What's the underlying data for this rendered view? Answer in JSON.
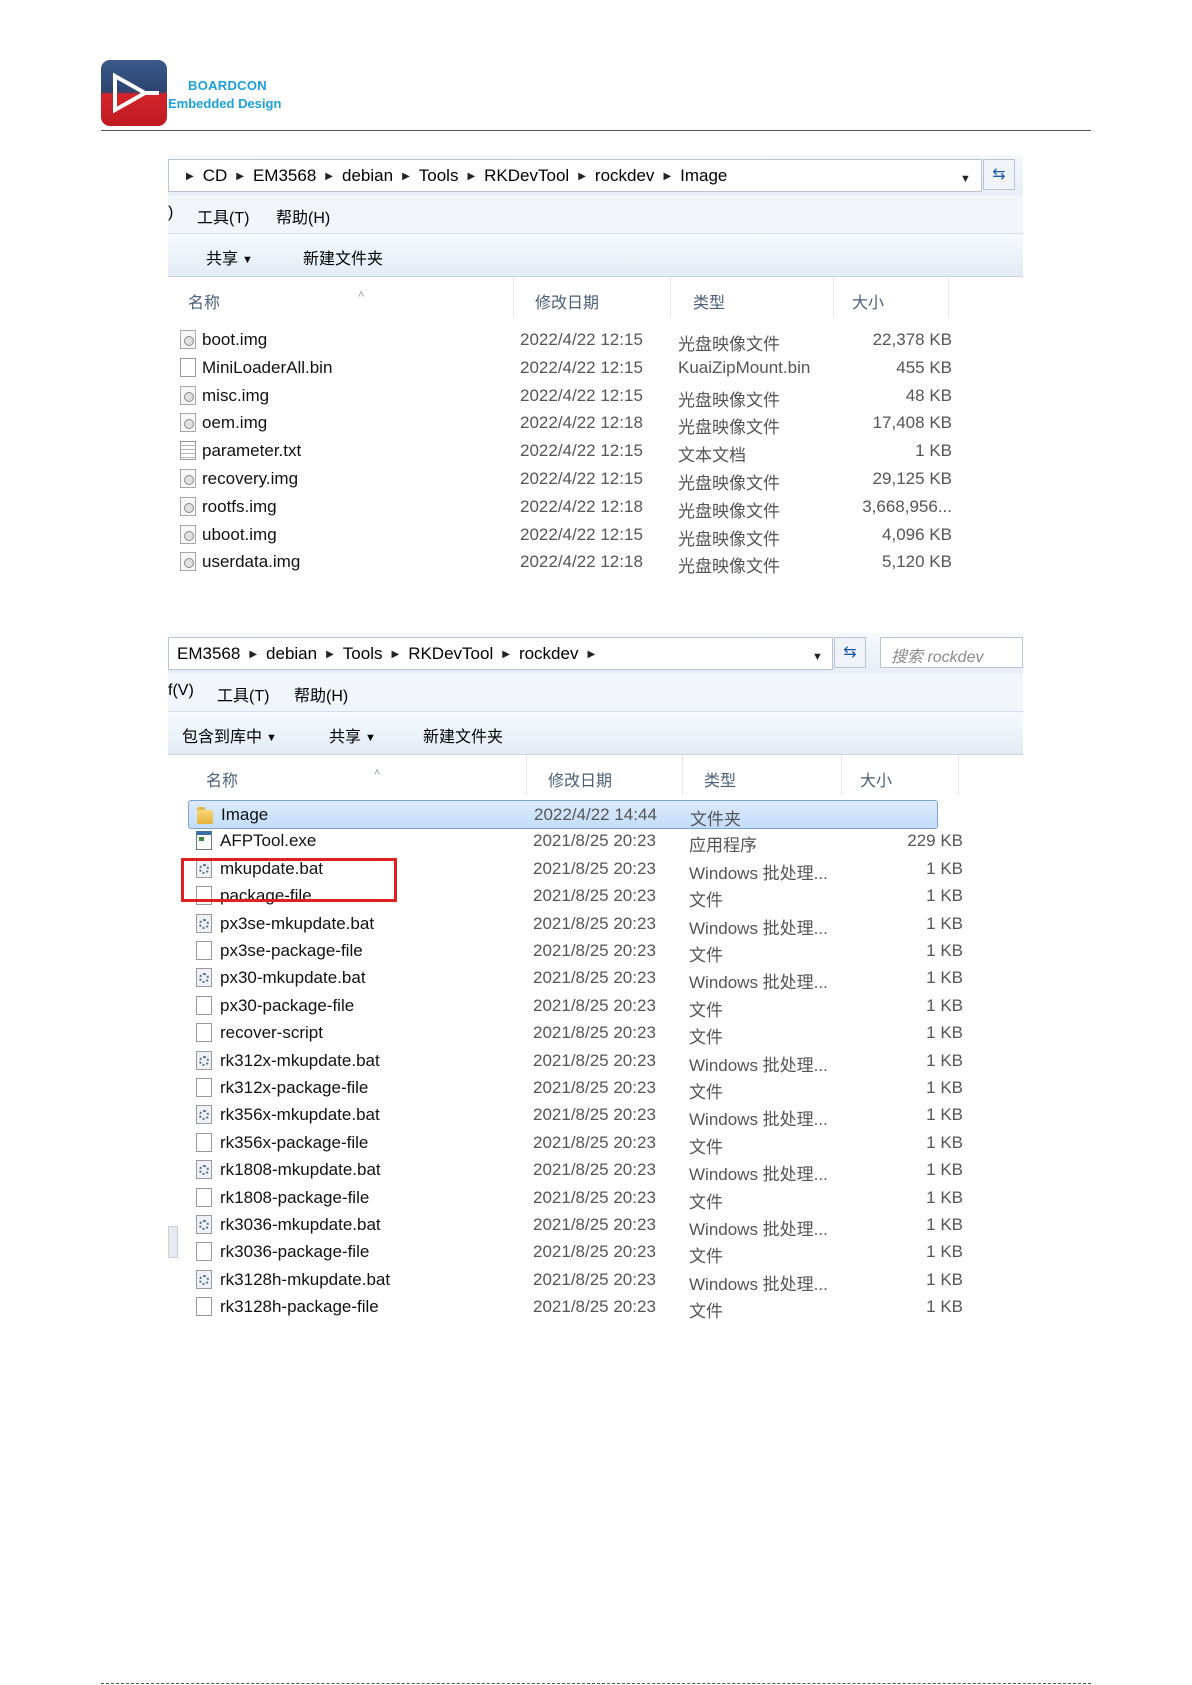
{
  "header": {
    "brand_name": "BOARDCON",
    "brand_sub": "Embedded Design"
  },
  "window1": {
    "breadcrumbs": [
      "CD",
      "EM3568",
      "debian",
      "Tools",
      "RKDevTool",
      "rockdev",
      "Image"
    ],
    "menus": [
      ")",
      "工具(T)",
      "帮助(H)"
    ],
    "commands": [
      "共享",
      "新建文件夹"
    ],
    "columns": {
      "name": "名称",
      "date": "修改日期",
      "type": "类型",
      "size": "大小"
    },
    "files": [
      {
        "name": "boot.img",
        "date": "2022/4/22 12:15",
        "type": "光盘映像文件",
        "size": "22,378 KB",
        "icon": "disc-image-icon"
      },
      {
        "name": "MiniLoaderAll.bin",
        "date": "2022/4/22 12:15",
        "type": "KuaiZipMount.bin",
        "size": "455 KB",
        "icon": "blank-file-icon"
      },
      {
        "name": "misc.img",
        "date": "2022/4/22 12:15",
        "type": "光盘映像文件",
        "size": "48 KB",
        "icon": "disc-image-icon"
      },
      {
        "name": "oem.img",
        "date": "2022/4/22 12:18",
        "type": "光盘映像文件",
        "size": "17,408 KB",
        "icon": "disc-image-icon"
      },
      {
        "name": "parameter.txt",
        "date": "2022/4/22 12:15",
        "type": "文本文档",
        "size": "1 KB",
        "icon": "text-file-icon"
      },
      {
        "name": "recovery.img",
        "date": "2022/4/22 12:15",
        "type": "光盘映像文件",
        "size": "29,125 KB",
        "icon": "disc-image-icon"
      },
      {
        "name": "rootfs.img",
        "date": "2022/4/22 12:18",
        "type": "光盘映像文件",
        "size": "3,668,956...",
        "icon": "disc-image-icon"
      },
      {
        "name": "uboot.img",
        "date": "2022/4/22 12:15",
        "type": "光盘映像文件",
        "size": "4,096 KB",
        "icon": "disc-image-icon"
      },
      {
        "name": "userdata.img",
        "date": "2022/4/22 12:18",
        "type": "光盘映像文件",
        "size": "5,120 KB",
        "icon": "disc-image-icon"
      }
    ]
  },
  "window2": {
    "breadcrumbs": [
      "EM3568",
      "debian",
      "Tools",
      "RKDevTool",
      "rockdev"
    ],
    "search_placeholder": "搜索 rockdev",
    "menus": [
      "f(V)",
      "工具(T)",
      "帮助(H)"
    ],
    "commands": [
      "包含到库中",
      "共享",
      "新建文件夹"
    ],
    "columns": {
      "name": "名称",
      "date": "修改日期",
      "type": "类型",
      "size": "大小"
    },
    "files": [
      {
        "name": "Image",
        "date": "2022/4/22 14:44",
        "type": "文件夹",
        "size": "",
        "icon": "folder-icon"
      },
      {
        "name": "AFPTool.exe",
        "date": "2021/8/25 20:23",
        "type": "应用程序",
        "size": "229 KB",
        "icon": "exe-icon"
      },
      {
        "name": "mkupdate.bat",
        "date": "2021/8/25 20:23",
        "type": "Windows 批处理...",
        "size": "1 KB",
        "icon": "batch-file-icon"
      },
      {
        "name": "package-file",
        "date": "2021/8/25 20:23",
        "type": "文件",
        "size": "1 KB",
        "icon": "blank-file-icon"
      },
      {
        "name": "px3se-mkupdate.bat",
        "date": "2021/8/25 20:23",
        "type": "Windows 批处理...",
        "size": "1 KB",
        "icon": "batch-file-icon"
      },
      {
        "name": "px3se-package-file",
        "date": "2021/8/25 20:23",
        "type": "文件",
        "size": "1 KB",
        "icon": "blank-file-icon"
      },
      {
        "name": "px30-mkupdate.bat",
        "date": "2021/8/25 20:23",
        "type": "Windows 批处理...",
        "size": "1 KB",
        "icon": "batch-file-icon"
      },
      {
        "name": "px30-package-file",
        "date": "2021/8/25 20:23",
        "type": "文件",
        "size": "1 KB",
        "icon": "blank-file-icon"
      },
      {
        "name": "recover-script",
        "date": "2021/8/25 20:23",
        "type": "文件",
        "size": "1 KB",
        "icon": "blank-file-icon"
      },
      {
        "name": "rk312x-mkupdate.bat",
        "date": "2021/8/25 20:23",
        "type": "Windows 批处理...",
        "size": "1 KB",
        "icon": "batch-file-icon"
      },
      {
        "name": "rk312x-package-file",
        "date": "2021/8/25 20:23",
        "type": "文件",
        "size": "1 KB",
        "icon": "blank-file-icon"
      },
      {
        "name": "rk356x-mkupdate.bat",
        "date": "2021/8/25 20:23",
        "type": "Windows 批处理...",
        "size": "1 KB",
        "icon": "batch-file-icon"
      },
      {
        "name": "rk356x-package-file",
        "date": "2021/8/25 20:23",
        "type": "文件",
        "size": "1 KB",
        "icon": "blank-file-icon"
      },
      {
        "name": "rk1808-mkupdate.bat",
        "date": "2021/8/25 20:23",
        "type": "Windows 批处理...",
        "size": "1 KB",
        "icon": "batch-file-icon"
      },
      {
        "name": "rk1808-package-file",
        "date": "2021/8/25 20:23",
        "type": "文件",
        "size": "1 KB",
        "icon": "blank-file-icon"
      },
      {
        "name": "rk3036-mkupdate.bat",
        "date": "2021/8/25 20:23",
        "type": "Windows 批处理...",
        "size": "1 KB",
        "icon": "batch-file-icon"
      },
      {
        "name": "rk3036-package-file",
        "date": "2021/8/25 20:23",
        "type": "文件",
        "size": "1 KB",
        "icon": "blank-file-icon"
      },
      {
        "name": "rk3128h-mkupdate.bat",
        "date": "2021/8/25 20:23",
        "type": "Windows 批处理...",
        "size": "1 KB",
        "icon": "batch-file-icon"
      },
      {
        "name": "rk3128h-package-file",
        "date": "2021/8/25 20:23",
        "type": "文件",
        "size": "1 KB",
        "icon": "blank-file-icon"
      }
    ]
  },
  "colors": {
    "brand_blue": "#1aa0dc",
    "highlight_red": "#e02020",
    "selection_blue": "#c4ddfa"
  }
}
